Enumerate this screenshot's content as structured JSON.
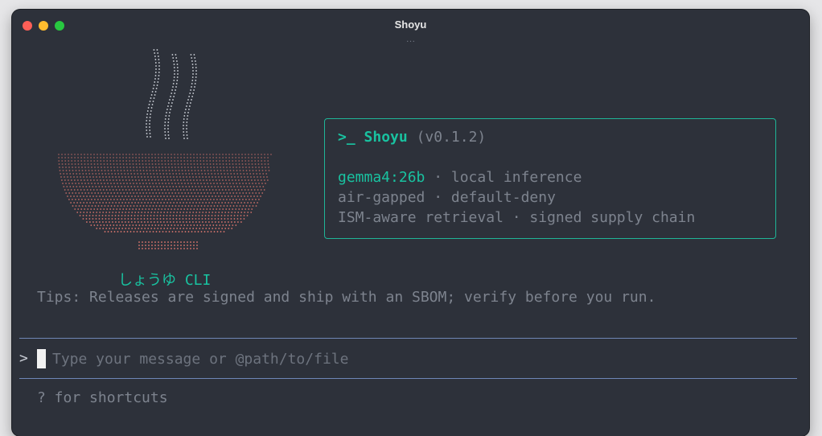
{
  "window": {
    "title": "Shoyu",
    "subtitle": "…"
  },
  "art": {
    "label": "しょうゆ CLI",
    "steam_color": "#d8dce3",
    "bowl_color": "#e97c72"
  },
  "info": {
    "prompt_glyph": ">_",
    "app_name": "Shoyu",
    "version": "(v0.1.2)",
    "model": "gemma4:26b",
    "model_detail": " · local inference",
    "line3": "air-gapped · default-deny",
    "line4": "ISM-aware retrieval · signed supply chain"
  },
  "tips": "Tips: Releases are signed and ship with an SBOM; verify before you run.",
  "input": {
    "prompt": ">",
    "placeholder": "Type your message or @path/to/file",
    "value": ""
  },
  "footer": {
    "shortcuts": "? for shortcuts"
  },
  "colors": {
    "accent": "#19c2a0",
    "background": "#2d313a",
    "muted": "#7d838e",
    "rule": "#6f86b6"
  }
}
